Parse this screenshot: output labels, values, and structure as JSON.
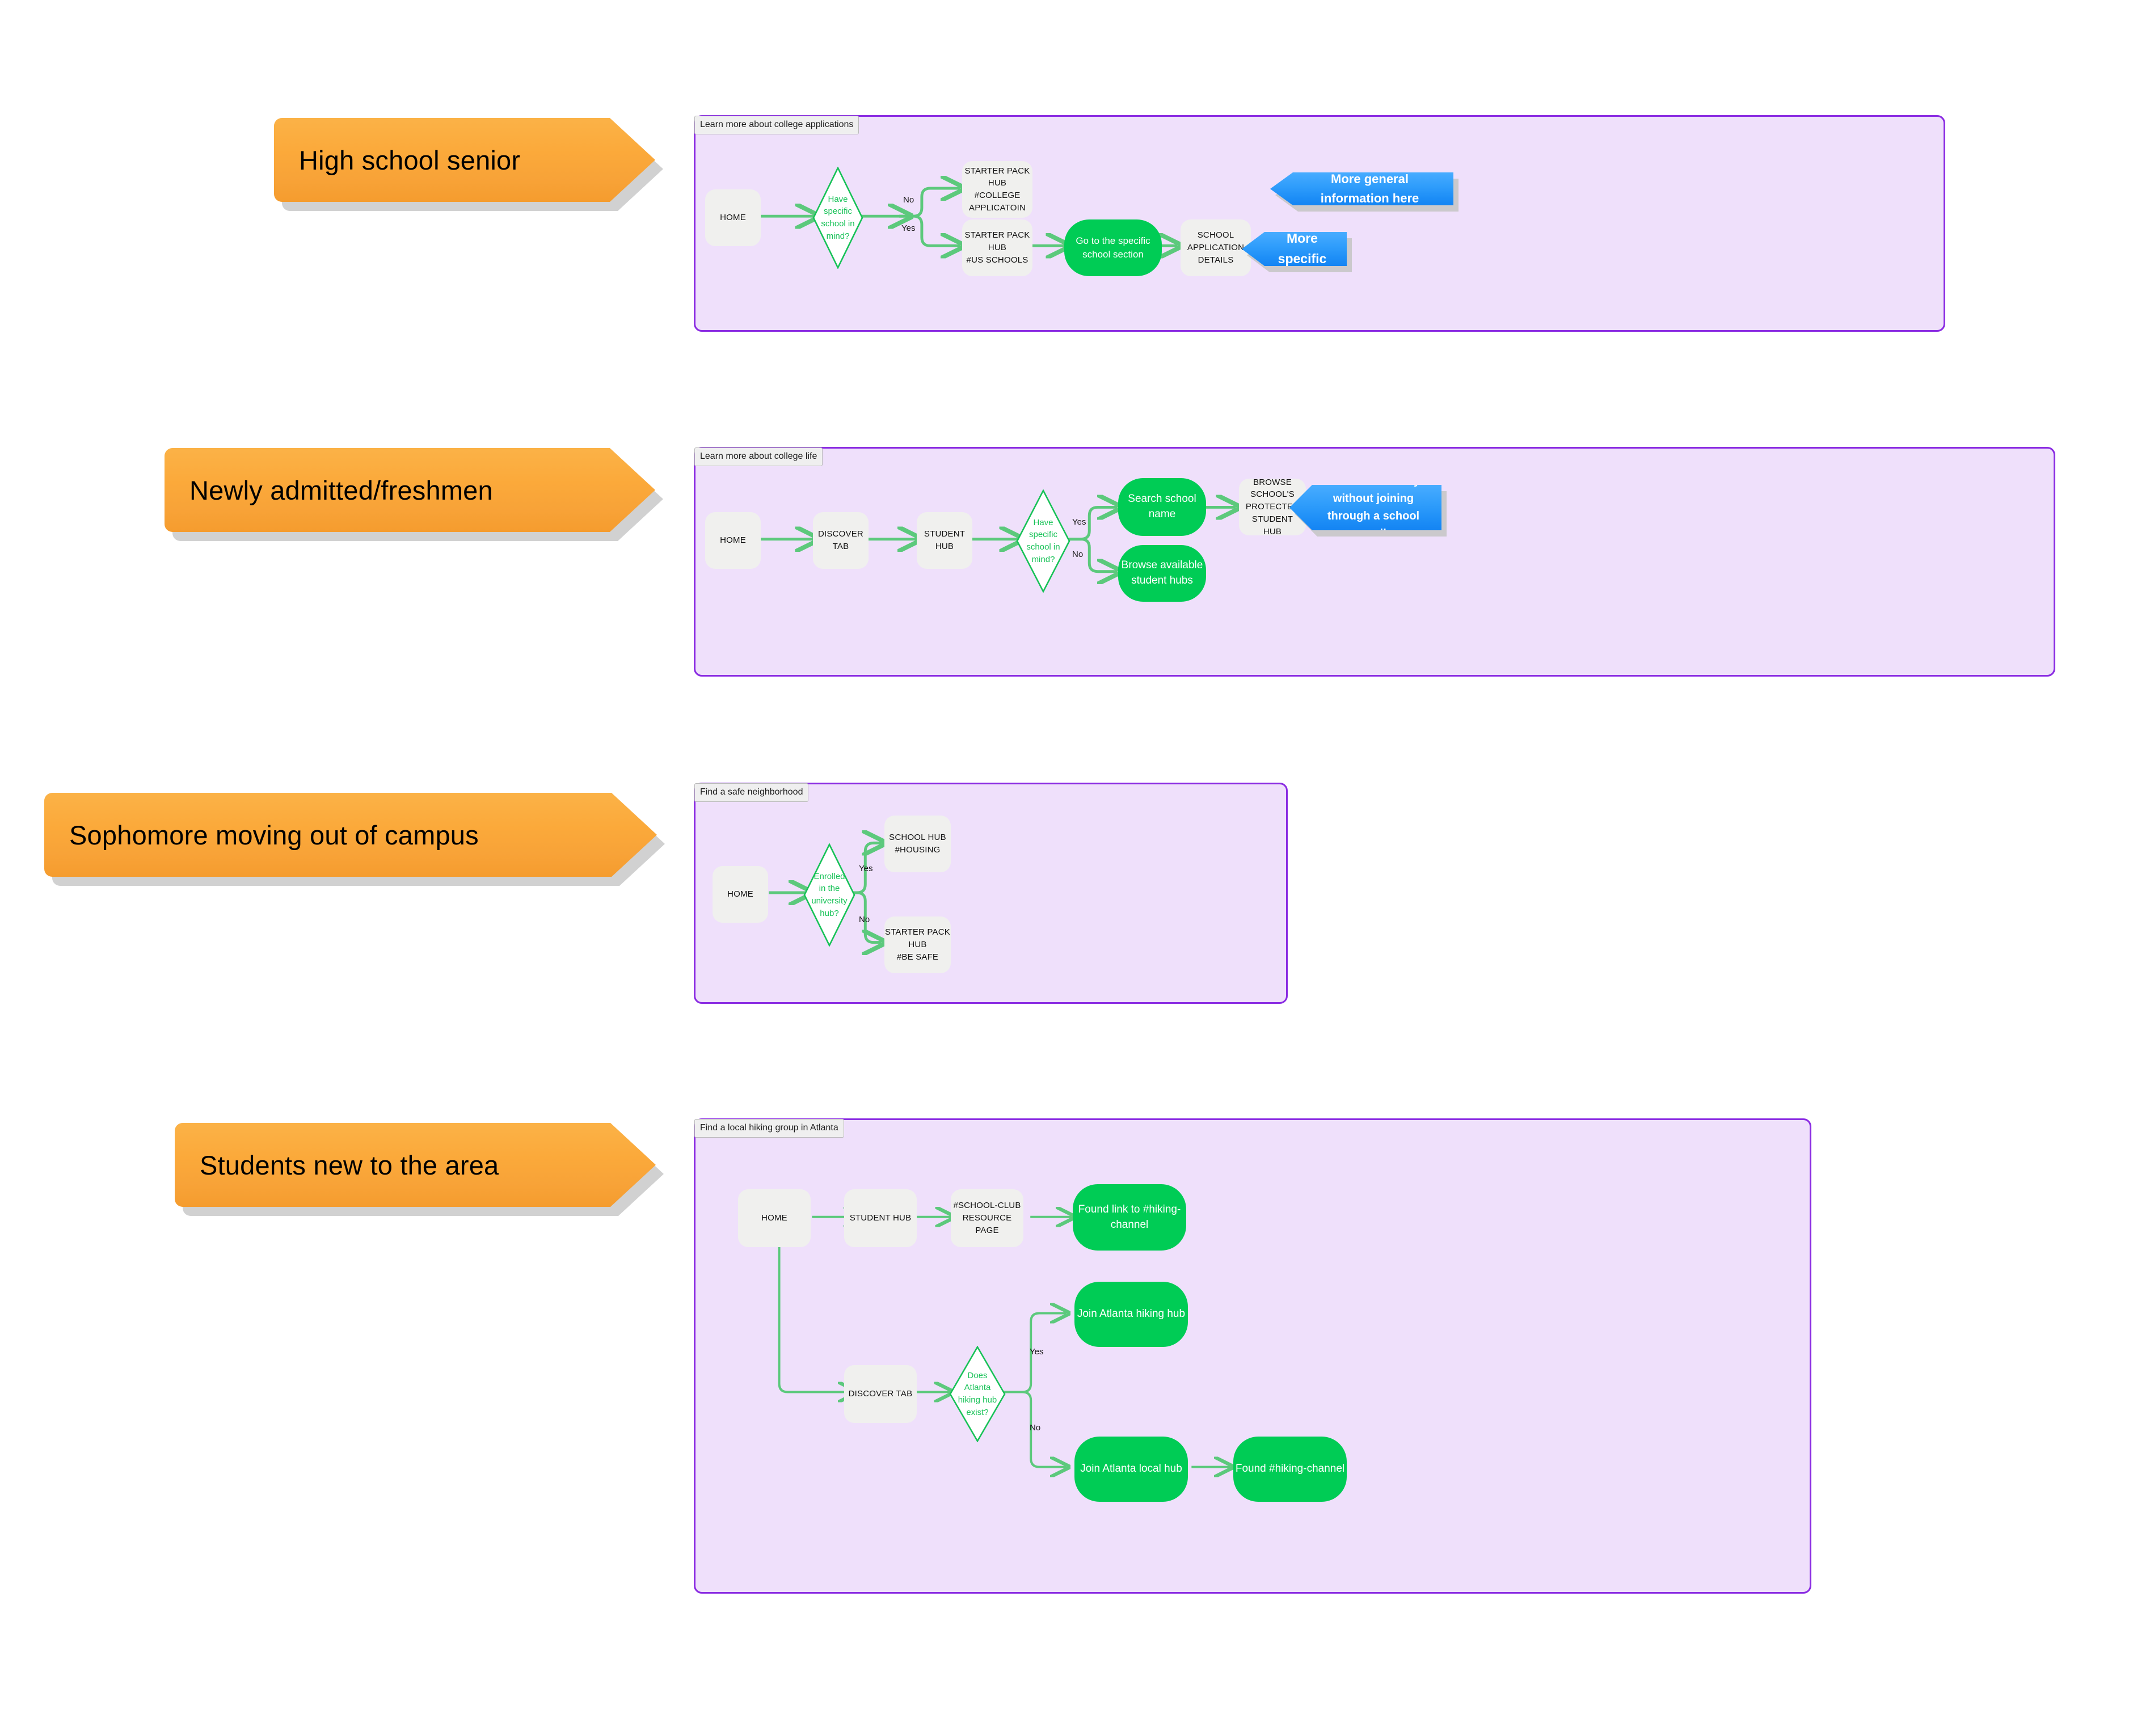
{
  "colors": {
    "panel_fill": "#EFE0FB",
    "panel_border": "#8A2BE2",
    "node_grey": "#F0F0EE",
    "node_green": "#00CC55",
    "callout_blue": "#2E9CFB",
    "persona_orange": "#FBA93A",
    "connector_green": "#5CC97C",
    "diamond_stroke": "#17C257",
    "page_background": "#FFFFFF"
  },
  "personas": [
    {
      "label": "High school senior"
    },
    {
      "label": "Newly admitted/freshmen"
    },
    {
      "label": "Sophomore moving out of campus"
    },
    {
      "label": "Students new to the area"
    }
  ],
  "panels": [
    {
      "tab": "Learn more about college applications",
      "nodes": {
        "home": "HOME",
        "decision": "Have specific\nschool in mind?",
        "hub_college_app": "STARTER PACK HUB\n#COLLEGE APPLICATOIN",
        "hub_us_schools": "STARTER PACK HUB\n#US SCHOOLS",
        "go_school_section": "Go to the specific school section",
        "school_app_details": "SCHOOL APPLICATION\nDETAILS"
      },
      "edge_labels": {
        "no": "No",
        "yes": "Yes"
      },
      "callouts": {
        "general": "More general information here",
        "specific": "More specific"
      }
    },
    {
      "tab": "Learn more about college life",
      "nodes": {
        "home": "HOME",
        "discover_tab": "DISCOVER TAB",
        "student_hub": "STUDENT HUB",
        "decision": "Have specific\nschool in mind?",
        "search_school": "Search school name",
        "browse_hubs": "Browse available student hubs",
        "protected_hub": "BROWSE SCHOOL'S\nPROTECTED STUDENT\nHUB"
      },
      "edge_labels": {
        "yes": "Yes",
        "no": "No"
      },
      "callouts": {
        "view_access": "View access only without joining through a school email."
      }
    },
    {
      "tab": "Find a safe neighborhood",
      "nodes": {
        "home": "HOME",
        "decision": "Enrolled in the\nuniversity hub?",
        "school_hub_housing": "SCHOOL HUB\n#HOUSING",
        "starter_be_safe": "STARTER PACK HUB\n#BE SAFE"
      },
      "edge_labels": {
        "yes": "Yes",
        "no": "No"
      }
    },
    {
      "tab": "Find a local hiking group in Atlanta",
      "nodes": {
        "home": "HOME",
        "student_hub": "STUDENT HUB",
        "resource_page": "#SCHOOL-CLUB\nRESOURCE PAGE",
        "found_link": "Found link to #hiking-channel",
        "discover_tab": "DISCOVER TAB",
        "decision": "Does Atlanta\nhiking hub exist?",
        "join_hiking_hub": "Join Atlanta hiking hub",
        "join_local_hub": "Join Atlanta local hub",
        "found_channel": "Found #hiking-channel"
      },
      "edge_labels": {
        "yes": "Yes",
        "no": "No"
      }
    }
  ]
}
